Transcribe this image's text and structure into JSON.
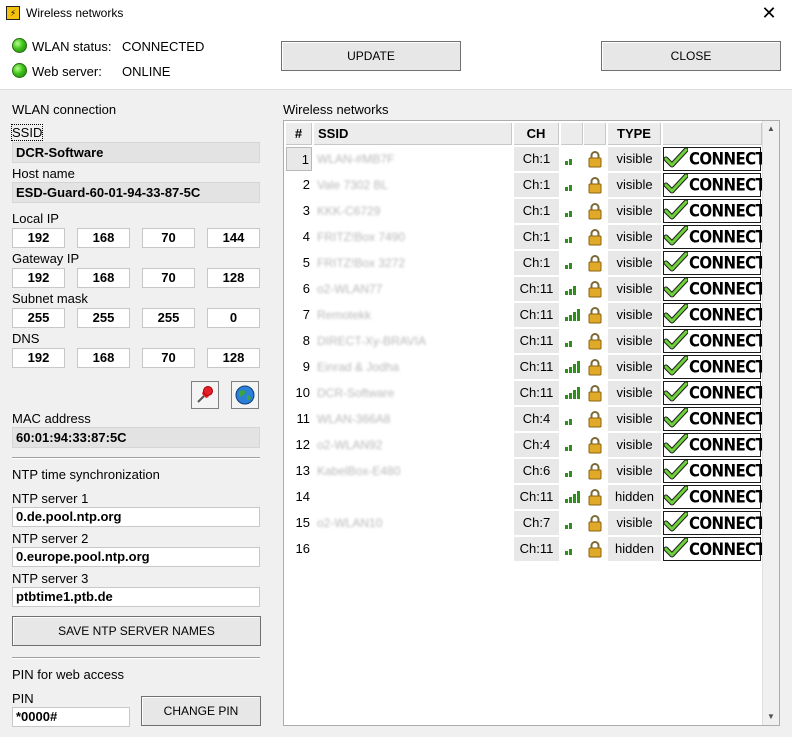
{
  "window": {
    "title": "Wireless networks"
  },
  "status": {
    "wlan_label": "WLAN status:",
    "wlan_value": "CONNECTED",
    "web_label": "Web server:",
    "web_value": "ONLINE"
  },
  "buttons": {
    "update": "UPDATE",
    "close": "CLOSE",
    "save_ntp": "SAVE NTP SERVER NAMES",
    "change_pin": "CHANGE PIN"
  },
  "wlan": {
    "section": "WLAN connection",
    "ssid_label": "SSID",
    "ssid": "DCR-Software",
    "host_label": "Host name",
    "host": "ESD-Guard-60-01-94-33-87-5C",
    "local_ip_label": "Local IP",
    "local_ip": [
      "192",
      "168",
      "70",
      "144"
    ],
    "gateway_label": "Gateway IP",
    "gateway": [
      "192",
      "168",
      "70",
      "128"
    ],
    "subnet_label": "Subnet mask",
    "subnet": [
      "255",
      "255",
      "255",
      "0"
    ],
    "dns_label": "DNS",
    "dns": [
      "192",
      "168",
      "70",
      "128"
    ],
    "mac_label": "MAC address",
    "mac": "60:01:94:33:87:5C"
  },
  "ntp": {
    "section": "NTP time synchronization",
    "s1_label": "NTP server 1",
    "s1": "0.de.pool.ntp.org",
    "s2_label": "NTP server 2",
    "s2": "0.europe.pool.ntp.org",
    "s3_label": "NTP server 3",
    "s3": "ptbtime1.ptb.de"
  },
  "pin": {
    "section": "PIN for web access",
    "label": "PIN",
    "value": "*0000#"
  },
  "networks": {
    "section": "Wireless networks",
    "headers": {
      "num": "#",
      "ssid": "SSID",
      "ch": "CH",
      "type": "TYPE"
    },
    "connect_label": "CONNECT",
    "rows": [
      {
        "num": "1",
        "ssid": "WLAN-#MB7F",
        "ch": "Ch:1",
        "signal": 2,
        "type": "visible"
      },
      {
        "num": "2",
        "ssid": "Vale 7302 BL",
        "ch": "Ch:1",
        "signal": 2,
        "type": "visible"
      },
      {
        "num": "3",
        "ssid": "KKK-C6729",
        "ch": "Ch:1",
        "signal": 2,
        "type": "visible"
      },
      {
        "num": "4",
        "ssid": "FRITZ!Box 7490",
        "ch": "Ch:1",
        "signal": 2,
        "type": "visible"
      },
      {
        "num": "5",
        "ssid": "FRITZ!Box 3272",
        "ch": "Ch:1",
        "signal": 2,
        "type": "visible"
      },
      {
        "num": "6",
        "ssid": "o2-WLAN77",
        "ch": "Ch:11",
        "signal": 3,
        "type": "visible"
      },
      {
        "num": "7",
        "ssid": "Remotekk",
        "ch": "Ch:11",
        "signal": 4,
        "type": "visible"
      },
      {
        "num": "8",
        "ssid": "DIRECT-Xy-BRAVIA",
        "ch": "Ch:11",
        "signal": 2,
        "type": "visible"
      },
      {
        "num": "9",
        "ssid": "Einrad & Jodha",
        "ch": "Ch:11",
        "signal": 4,
        "type": "visible"
      },
      {
        "num": "10",
        "ssid": "DCR-Software",
        "ch": "Ch:11",
        "signal": 4,
        "type": "visible"
      },
      {
        "num": "11",
        "ssid": "WLAN-366A8",
        "ch": "Ch:4",
        "signal": 2,
        "type": "visible"
      },
      {
        "num": "12",
        "ssid": "o2-WLAN92",
        "ch": "Ch:4",
        "signal": 2,
        "type": "visible"
      },
      {
        "num": "13",
        "ssid": "KabelBox-E480",
        "ch": "Ch:6",
        "signal": 2,
        "type": "visible"
      },
      {
        "num": "14",
        "ssid": "",
        "ch": "Ch:11",
        "signal": 4,
        "type": "hidden"
      },
      {
        "num": "15",
        "ssid": "o2-WLAN10",
        "ch": "Ch:7",
        "signal": 2,
        "type": "visible"
      },
      {
        "num": "16",
        "ssid": "",
        "ch": "Ch:11",
        "signal": 2,
        "type": "hidden"
      }
    ]
  }
}
